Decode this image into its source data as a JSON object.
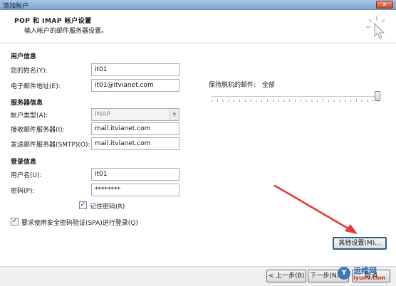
{
  "window": {
    "title": "添加帐户",
    "close_label": "✕"
  },
  "header": {
    "title": "POP 和 IMAP 帐户设置",
    "subtitle": "输入帐户的邮件服务器设置。"
  },
  "user_info": {
    "section": "用户信息",
    "name_label": "您的姓名(Y):",
    "name_value": "it01",
    "email_label": "电子邮件地址(E):",
    "email_value": "it01@itvianet.com"
  },
  "server_info": {
    "section": "服务器信息",
    "account_type_label": "帐户类型(A):",
    "account_type_value": "IMAP",
    "incoming_label": "接收邮件服务器(I):",
    "incoming_value": "mail.itvianet.com",
    "outgoing_label": "发送邮件服务器(SMTP)(O):",
    "outgoing_value": "mail.itvianet.com"
  },
  "login_info": {
    "section": "登录信息",
    "username_label": "用户名(U):",
    "username_value": "it01",
    "password_label": "密码(P):",
    "password_value": "********",
    "remember_label": "记住密码(R)",
    "remember_checked": true,
    "spa_label": "要求使用安全密码验证(SPA)进行登录(Q)",
    "spa_checked": true
  },
  "offline": {
    "label": "保持脱机的邮件:",
    "value": "全部",
    "slider_level": 1.0
  },
  "buttons": {
    "more_settings": "其他设置(M)...",
    "back": "< 上一步(B)",
    "next": "下一步(N) >",
    "cancel": "取消"
  },
  "watermark": {
    "logo_text": "Y",
    "line1": "运维网",
    "line2": "iyunv.com"
  },
  "colors": {
    "title_bar": "#7fa3cf",
    "annotation_arrow": "#e53935"
  }
}
